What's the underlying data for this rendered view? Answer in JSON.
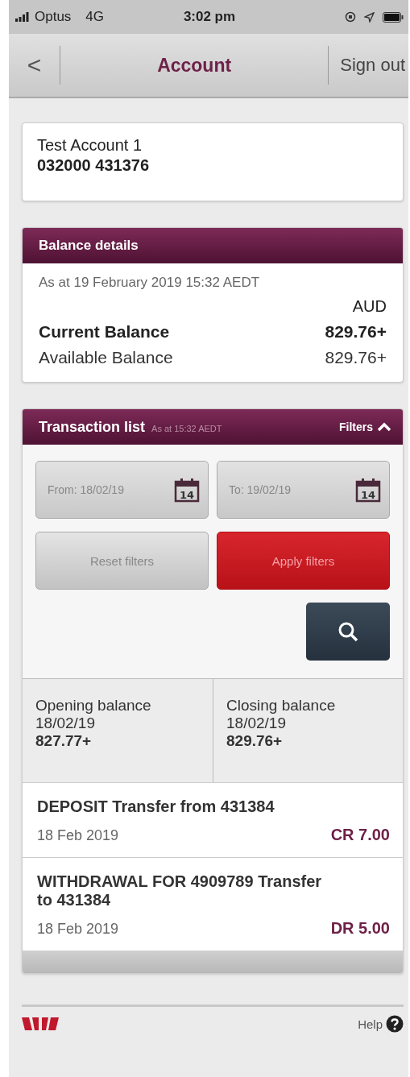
{
  "status_bar": {
    "carrier": "Optus",
    "network": "4G",
    "time": "3:02 pm"
  },
  "nav_bar": {
    "back": "<",
    "title": "Account",
    "sign_out": "Sign out"
  },
  "account": {
    "name": "Test Account 1",
    "number": "032000 431376"
  },
  "balance_details": {
    "title": "Balance details",
    "as_at": "As at 19 February 2019 15:32 AEDT",
    "currency": "AUD",
    "rows": [
      {
        "label": "Current Balance",
        "value": "829.76+",
        "emphasis": true
      },
      {
        "label": "Available Balance",
        "value": "829.76+",
        "emphasis": false
      }
    ]
  },
  "transaction_list": {
    "title": "Transaction list",
    "as_at": "As at 15:32 AEDT",
    "filters_label": "Filters",
    "filters_expanded": true,
    "date_fields": [
      {
        "value": "From: 18/02/19",
        "icon_day": "14"
      },
      {
        "value": "To: 19/02/19",
        "icon_day": "14"
      }
    ],
    "buttons": [
      {
        "label": "Reset filters",
        "kind": "secondary"
      },
      {
        "label": "Apply filters",
        "kind": "primary"
      }
    ],
    "summary": [
      {
        "label": "Opening balance",
        "date": "18/02/19",
        "amount": "827.77+"
      },
      {
        "label": "Closing balance",
        "date": "18/02/19",
        "amount": "829.76+"
      }
    ],
    "transactions": [
      {
        "description": "DEPOSIT Transfer from 431384",
        "date": "18 Feb 2019",
        "amount": "CR 7.00"
      },
      {
        "description": "WITHDRAWAL FOR 4909789 Transfer to 431384",
        "date": "18 Feb 2019",
        "amount": "DR 5.00"
      }
    ]
  },
  "footer": {
    "help": "Help"
  }
}
